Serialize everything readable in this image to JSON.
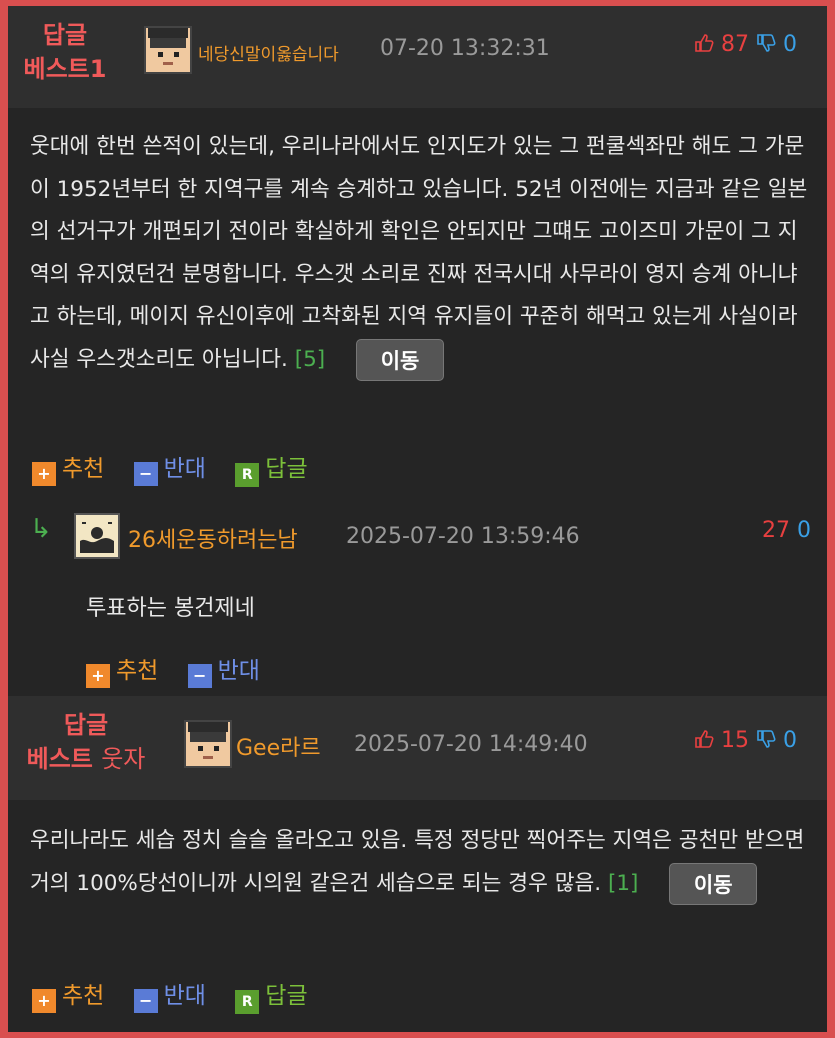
{
  "best1": {
    "label_line1": "답글",
    "label_line2": "베스트1",
    "nickname": "네당신말이옳습니다",
    "datetime": "07-20 13:32:31",
    "upvotes": "87",
    "downvotes": "0",
    "body": "웃대에 한번 쓴적이 있는데, 우리나라에서도 인지도가 있는 그 펀쿨섹좌만 해도 그 가문이 1952년부터 한 지역구를 계속 승계하고 있습니다. 52년 이전에는 지금과 같은 일본의 선거구가 개편되기 전이라 확실하게 확인은 안되지만 그떄도 고이즈미 가문이 그 지역의 유지였던건 분명합니다. 우스갯 소리로 진짜 전국시대 사무라이 영지 승계 아니냐고 하는데, 메이지 유신이후에 고착화된 지역 유지들이 꾸준히 해먹고 있는게 사실이라 사실 우스갯소리도 아닙니다.",
    "ref": "[5]",
    "move_label": "이동",
    "recommend_label": "추천",
    "oppose_label": "반대",
    "reply_label": "답글"
  },
  "reply1": {
    "arrow": "↳",
    "nickname": "26세운동하려는남",
    "datetime": "2025-07-20 13:59:46",
    "upvotes": "27",
    "downvotes": "0",
    "body": "투표하는 봉건제네",
    "recommend_label": "추천",
    "oppose_label": "반대"
  },
  "best2": {
    "label_line1": "답글",
    "label_line2a": "베스트",
    "label_line2b": "웃자",
    "nickname": "Gee라르",
    "datetime": "2025-07-20 14:49:40",
    "upvotes": "15",
    "downvotes": "0",
    "body": "우리나라도 세습 정치 슬슬 올라오고 있음. 특정 정당만 찍어주는 지역은 공천만 받으면 거의 100%당선이니까 시의원 같은건 세습으로 되는 경우 많음.",
    "ref": "[1]",
    "move_label": "이동",
    "recommend_label": "추천",
    "oppose_label": "반대",
    "reply_label": "답글"
  },
  "icons": {
    "plus": "+",
    "minus": "−",
    "r": "R"
  },
  "colors": {
    "frame": "#d94f4f",
    "up": "#e84040",
    "down": "#3aa0e6",
    "nick": "#f09a2c",
    "best": "#f05a5a"
  }
}
